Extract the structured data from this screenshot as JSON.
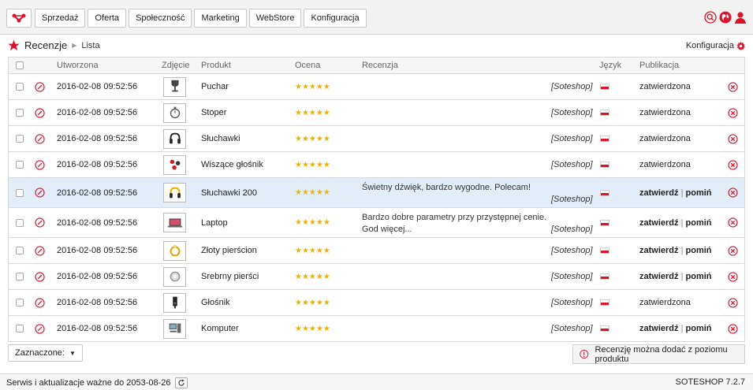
{
  "nav": {
    "logo_icon": "sote-logo-icon",
    "items": [
      "Sprzedaż",
      "Oferta",
      "Społeczność",
      "Marketing",
      "WebStore",
      "Konfiguracja"
    ],
    "icons": [
      "search-icon",
      "globe-icon",
      "user-icon"
    ]
  },
  "breadcrumb": {
    "title": "Recenzje",
    "sub": "Lista"
  },
  "config_link": {
    "label": "Konfiguracja"
  },
  "table": {
    "columns": {
      "created": "Utworzona",
      "photo": "Zdjęcie",
      "product": "Produkt",
      "rating": "Ocena",
      "review": "Recenzja",
      "language": "Język",
      "publication": "Publikacja"
    },
    "rows": [
      {
        "date": "2016-02-08 09:52:56",
        "thumb": "trophy",
        "product": "Puchar",
        "stars": "★★★★★",
        "review": "",
        "shop": "[Soteshop]",
        "status": "zatwierdzona",
        "pending": false
      },
      {
        "date": "2016-02-08 09:52:56",
        "thumb": "stopwatch",
        "product": "Stoper",
        "stars": "★★★★★",
        "review": "",
        "shop": "[Soteshop]",
        "status": "zatwierdzona",
        "pending": false
      },
      {
        "date": "2016-02-08 09:52:56",
        "thumb": "headphones",
        "product": "Słuchawki",
        "stars": "★★★★★",
        "review": "",
        "shop": "[Soteshop]",
        "status": "zatwierdzona",
        "pending": false
      },
      {
        "date": "2016-02-08 09:52:56",
        "thumb": "speaker",
        "product": "Wiszące głośnik",
        "stars": "★★★★★",
        "review": "",
        "shop": "[Soteshop]",
        "status": "zatwierdzona",
        "pending": false
      },
      {
        "date": "2016-02-08 09:52:56",
        "thumb": "headphones-yellow",
        "product": "Słuchawki 200",
        "stars": "★★★★★",
        "review": "Świetny dźwięk, bardzo wygodne. Polecam!",
        "shop": "[Soteshop]",
        "approve": "zatwierdź",
        "sep": "|",
        "reject": "pomiń",
        "pending": true
      },
      {
        "date": "2016-02-08 09:52:56",
        "thumb": "laptop",
        "product": "Laptop",
        "stars": "★★★★★",
        "review": "Bardzo dobre parametry przy przystępnej cenie. God więcej...",
        "shop": "[Soteshop]",
        "approve": "zatwierdź",
        "sep": "|",
        "reject": "pomiń",
        "pending": true
      },
      {
        "date": "2016-02-08 09:52:56",
        "thumb": "ring",
        "product": "Złoty pierścion",
        "stars": "★★★★★",
        "review": "",
        "shop": "[Soteshop]",
        "approve": "zatwierdź",
        "sep": "|",
        "reject": "pomiń",
        "pending": true
      },
      {
        "date": "2016-02-08 09:52:56",
        "thumb": "silver-ring",
        "product": "Srebrny pierści",
        "stars": "★★★★★",
        "review": "",
        "shop": "[Soteshop]",
        "approve": "zatwierdź",
        "sep": "|",
        "reject": "pomiń",
        "pending": true
      },
      {
        "date": "2016-02-08 09:52:56",
        "thumb": "loudspeaker",
        "product": "Głośnik",
        "stars": "★★★★★",
        "review": "",
        "shop": "[Soteshop]",
        "status": "zatwierdzona",
        "pending": false
      },
      {
        "date": "2016-02-08 09:52:56",
        "thumb": "computer",
        "product": "Komputer",
        "stars": "★★★★★",
        "review": "",
        "shop": "[Soteshop]",
        "approve": "zatwierdź",
        "sep": "|",
        "reject": "pomiń",
        "pending": true
      }
    ]
  },
  "bulk_select": {
    "label": "Zaznaczone:"
  },
  "notice": {
    "text": "Recenzję można dodać z poziomu produktu"
  },
  "status": {
    "left": "Serwis i aktualizacje ważne do 2053-08-26",
    "right": "SOTESHOP 7.2.7"
  },
  "colors": {
    "accent": "#d9142b",
    "star": "#e8b20a",
    "selected_row": "#e3edf8"
  }
}
